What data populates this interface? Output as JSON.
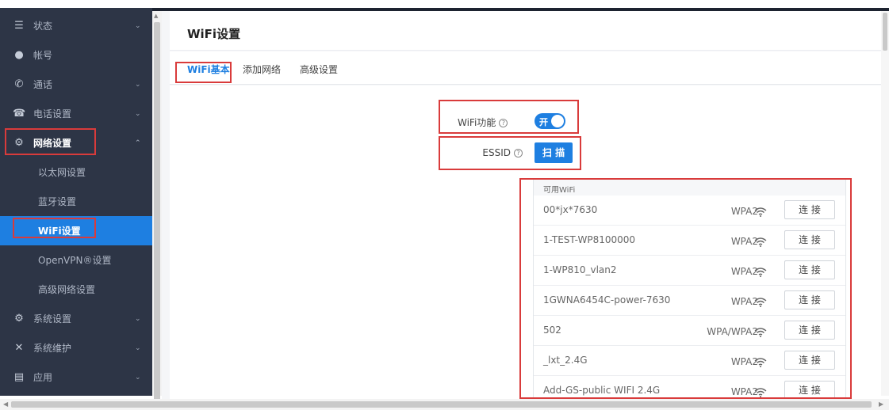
{
  "sidebar": {
    "items": [
      {
        "icon": "list-icon",
        "glyph": "☰",
        "label": "状态",
        "chevron": "⌄"
      },
      {
        "icon": "user-icon",
        "glyph": "●",
        "label": "帐号",
        "chevron": ""
      },
      {
        "icon": "call-icon",
        "glyph": "✆",
        "label": "通话",
        "chevron": "⌄"
      },
      {
        "icon": "phone-icon",
        "glyph": "☎",
        "label": "电话设置",
        "chevron": "⌄"
      },
      {
        "icon": "network-icon",
        "glyph": "⚙",
        "label": "网络设置",
        "chevron": "⌃"
      },
      {
        "icon": "",
        "glyph": "",
        "label": "以太网设置",
        "chevron": ""
      },
      {
        "icon": "",
        "glyph": "",
        "label": "蓝牙设置",
        "chevron": ""
      },
      {
        "icon": "",
        "glyph": "",
        "label": "WiFi设置",
        "chevron": ""
      },
      {
        "icon": "",
        "glyph": "",
        "label": "OpenVPN®设置",
        "chevron": ""
      },
      {
        "icon": "",
        "glyph": "",
        "label": "高级网络设置",
        "chevron": ""
      },
      {
        "icon": "system-settings-icon",
        "glyph": "⚙",
        "label": "系统设置",
        "chevron": "⌄"
      },
      {
        "icon": "maintenance-icon",
        "glyph": "✕",
        "label": "系统维护",
        "chevron": "⌄"
      },
      {
        "icon": "app-icon",
        "glyph": "▤",
        "label": "应用",
        "chevron": "⌄"
      }
    ]
  },
  "header": {
    "title": "WiFi设置"
  },
  "tabs": [
    {
      "label": "WiFi基本"
    },
    {
      "label": "添加网络"
    },
    {
      "label": "高级设置"
    }
  ],
  "settings": {
    "wifi_function_label": "WiFi功能",
    "help_glyph": "?",
    "wifi_toggle_label": "开",
    "essid_label": "ESSID",
    "scan_label": "扫 描"
  },
  "wifi_list": {
    "header": "可用WiFi",
    "connect_label": "连 接",
    "networks": [
      {
        "ssid": "00*jx*7630",
        "security": "WPA2"
      },
      {
        "ssid": "1-TEST-WP8100000",
        "security": "WPA2"
      },
      {
        "ssid": "1-WP810_vlan2",
        "security": "WPA2"
      },
      {
        "ssid": "1GWNA6454C-power-7630",
        "security": "WPA2"
      },
      {
        "ssid": "502",
        "security": "WPA/WPA2"
      },
      {
        "ssid": "_lxt_2.4G",
        "security": "WPA2"
      },
      {
        "ssid": "Add-GS-public WIFI 2.4G",
        "security": "WPA2"
      }
    ]
  },
  "colors": {
    "accent": "#1e7fe1",
    "sidebar_bg": "#2d3546",
    "annotation": "#d93b3b"
  }
}
